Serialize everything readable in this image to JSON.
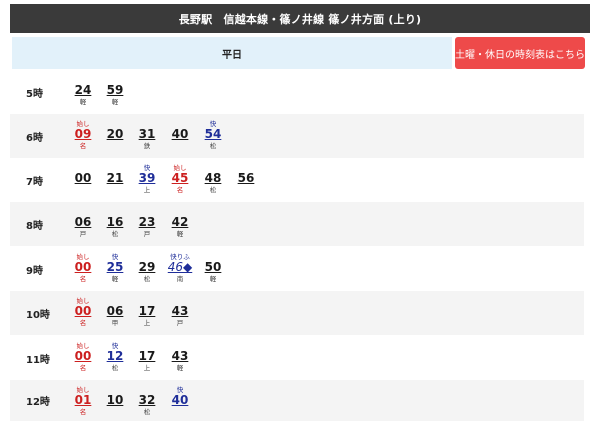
{
  "header": {
    "title": "長野駅　信越本線・篠ノ井線 篠ノ井方面 (上り)"
  },
  "tabs": {
    "weekday": "平日",
    "holiday": "土曜・休日の時刻表はこちら"
  },
  "colors": {
    "header_bg": "#3a3a3a",
    "tab_weekday_bg": "#e2f1fa",
    "tab_holiday_bg": "#ee4a4a",
    "red": "#cc1f1f",
    "blue": "#1f2e99"
  },
  "hours": [
    {
      "label": "5時",
      "deps": [
        {
          "mark": "",
          "min": "24",
          "dest": "軽",
          "color": "black"
        },
        {
          "mark": "",
          "min": "59",
          "dest": "軽",
          "color": "black"
        }
      ]
    },
    {
      "label": "6時",
      "deps": [
        {
          "mark": "始し",
          "min": "09",
          "dest": "名",
          "color": "red"
        },
        {
          "mark": "",
          "min": "20",
          "dest": "",
          "color": "black"
        },
        {
          "mark": "",
          "min": "31",
          "dest": "鉄",
          "color": "black"
        },
        {
          "mark": "",
          "min": "40",
          "dest": "",
          "color": "black"
        },
        {
          "mark": "快",
          "min": "54",
          "dest": "松",
          "color": "blue"
        }
      ]
    },
    {
      "label": "7時",
      "deps": [
        {
          "mark": "",
          "min": "00",
          "dest": "",
          "color": "black"
        },
        {
          "mark": "",
          "min": "21",
          "dest": "",
          "color": "black"
        },
        {
          "mark": "快",
          "min": "39",
          "dest": "上",
          "color": "blue"
        },
        {
          "mark": "始し",
          "min": "45",
          "dest": "名",
          "color": "red"
        },
        {
          "mark": "",
          "min": "48",
          "dest": "松",
          "color": "black"
        },
        {
          "mark": "",
          "min": "56",
          "dest": "",
          "color": "black"
        }
      ]
    },
    {
      "label": "8時",
      "deps": [
        {
          "mark": "",
          "min": "06",
          "dest": "戸",
          "color": "black"
        },
        {
          "mark": "",
          "min": "16",
          "dest": "松",
          "color": "black"
        },
        {
          "mark": "",
          "min": "23",
          "dest": "戸",
          "color": "black"
        },
        {
          "mark": "",
          "min": "42",
          "dest": "軽",
          "color": "black"
        }
      ]
    },
    {
      "label": "9時",
      "deps": [
        {
          "mark": "始し",
          "min": "00",
          "dest": "名",
          "color": "red"
        },
        {
          "mark": "快",
          "min": "25",
          "dest": "軽",
          "color": "blue"
        },
        {
          "mark": "",
          "min": "29",
          "dest": "松",
          "color": "black"
        },
        {
          "mark": "快りふ",
          "min": "46◆",
          "dest": "南",
          "color": "blue",
          "italic": true
        },
        {
          "mark": "",
          "min": "50",
          "dest": "軽",
          "color": "black"
        }
      ]
    },
    {
      "label": "10時",
      "deps": [
        {
          "mark": "始し",
          "min": "00",
          "dest": "名",
          "color": "red"
        },
        {
          "mark": "",
          "min": "06",
          "dest": "甲",
          "color": "black"
        },
        {
          "mark": "",
          "min": "17",
          "dest": "上",
          "color": "black"
        },
        {
          "mark": "",
          "min": "43",
          "dest": "戸",
          "color": "black"
        }
      ]
    },
    {
      "label": "11時",
      "deps": [
        {
          "mark": "始し",
          "min": "00",
          "dest": "名",
          "color": "red"
        },
        {
          "mark": "快",
          "min": "12",
          "dest": "松",
          "color": "blue"
        },
        {
          "mark": "",
          "min": "17",
          "dest": "上",
          "color": "black"
        },
        {
          "mark": "",
          "min": "43",
          "dest": "軽",
          "color": "black"
        }
      ]
    },
    {
      "label": "12時",
      "deps": [
        {
          "mark": "始し",
          "min": "01",
          "dest": "名",
          "color": "red"
        },
        {
          "mark": "",
          "min": "10",
          "dest": "",
          "color": "black"
        },
        {
          "mark": "",
          "min": "32",
          "dest": "松",
          "color": "black"
        },
        {
          "mark": "快",
          "min": "40",
          "dest": "",
          "color": "blue"
        }
      ]
    }
  ]
}
